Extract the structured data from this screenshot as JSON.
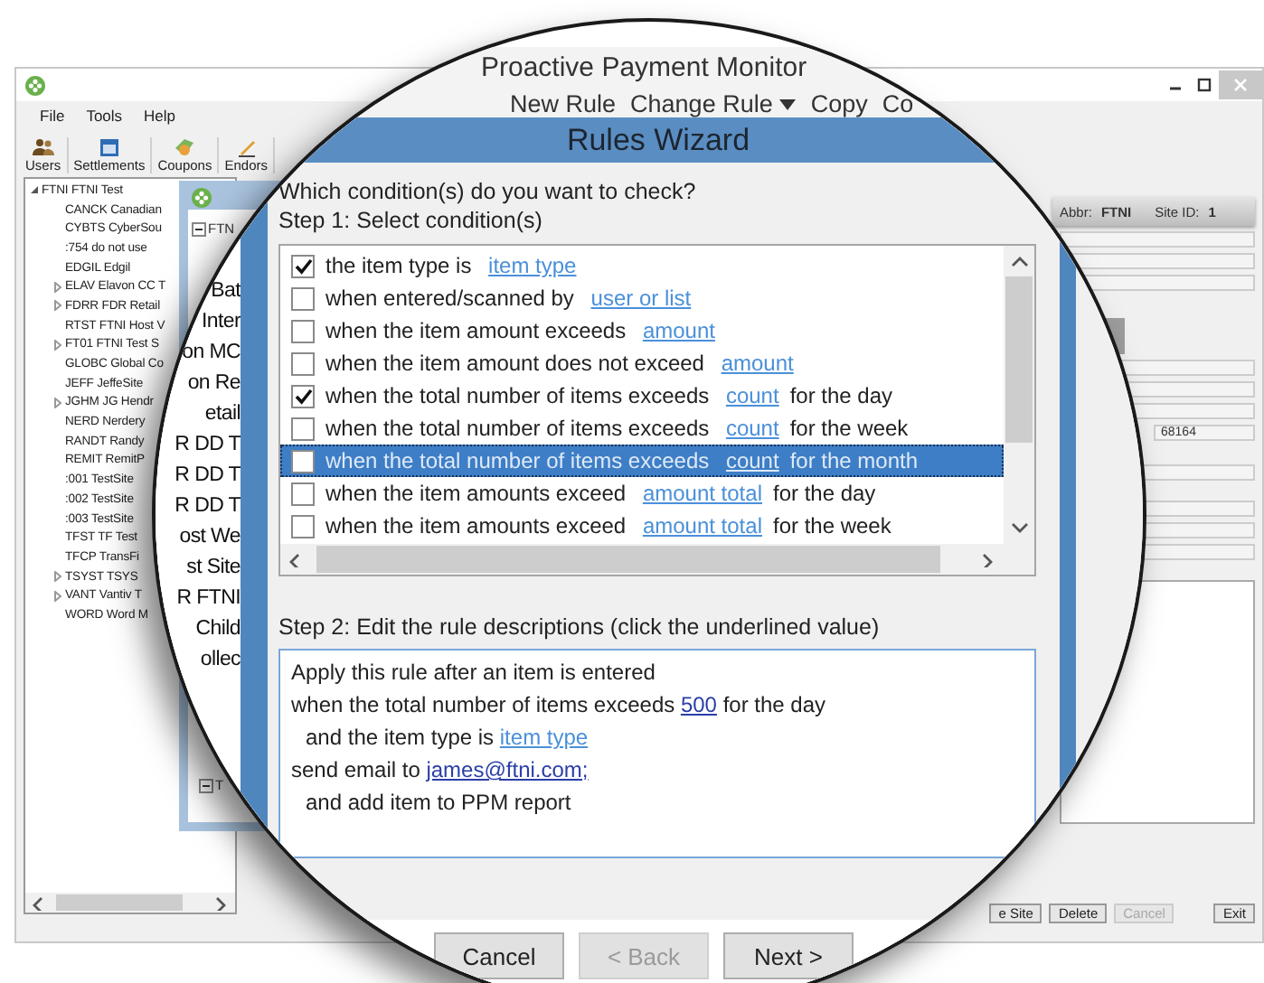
{
  "app": {
    "menu": [
      "File",
      "Tools",
      "Help"
    ],
    "toolbar": [
      "Users",
      "Settlements",
      "Coupons",
      "Endors"
    ],
    "tree": {
      "label": "FTNI FTNI Test",
      "expanded": true,
      "children": [
        {
          "label": "CANCK Canadian",
          "expandable": false
        },
        {
          "label": "CYBTS CyberSou",
          "expandable": false
        },
        {
          "label": ":754 do not use",
          "expandable": false
        },
        {
          "label": "EDGIL Edgil",
          "expandable": false
        },
        {
          "label": "ELAV Elavon CC T",
          "expandable": true
        },
        {
          "label": "FDRR FDR Retail",
          "expandable": true
        },
        {
          "label": "RTST FTNI Host V",
          "expandable": false
        },
        {
          "label": "FT01 FTNI Test S",
          "expandable": true
        },
        {
          "label": "GLOBC Global Co",
          "expandable": false
        },
        {
          "label": "JEFF JeffeSite",
          "expandable": false
        },
        {
          "label": "JGHM JG Hendr",
          "expandable": true
        },
        {
          "label": "NERD Nerdery",
          "expandable": false
        },
        {
          "label": "RANDT Randy",
          "expandable": false
        },
        {
          "label": "REMIT RemitP",
          "expandable": false
        },
        {
          "label": ":001 TestSite",
          "expandable": false
        },
        {
          "label": ":002 TestSite",
          "expandable": false
        },
        {
          "label": ":003 TestSite",
          "expandable": false
        },
        {
          "label": "TFST TF Test",
          "expandable": false
        },
        {
          "label": "TFCP TransFi",
          "expandable": false
        },
        {
          "label": "TSYST TSYS",
          "expandable": true
        },
        {
          "label": "VANT Vantiv T",
          "expandable": true
        },
        {
          "label": "WORD Word M",
          "expandable": false
        }
      ]
    },
    "site_header": {
      "abbr_label": "Abbr:",
      "abbr": "FTNI",
      "site_id_label": "Site ID:",
      "site_id": "1"
    },
    "field_value": "68164",
    "buttons": [
      {
        "label": "e Site",
        "disabled": false
      },
      {
        "label": "Delete",
        "disabled": false
      },
      {
        "label": "Cancel",
        "disabled": true
      },
      {
        "label": "Exit",
        "disabled": false
      }
    ]
  },
  "back_dialog": {
    "tree_top": "FTN",
    "tree_bottom": "T"
  },
  "magnifier": {
    "title": "Proactive Payment Monitor",
    "menu": [
      {
        "label": "New Rule",
        "dropdown": false
      },
      {
        "label": "Change Rule",
        "dropdown": true
      },
      {
        "label": "Copy",
        "dropdown": false
      },
      {
        "label": "Co",
        "dropdown": false
      }
    ],
    "background_text": [
      "Bat",
      "Inter",
      "on MC",
      "on Re",
      "etail",
      "R DD T",
      "R DD T",
      "R DD T",
      "ost We",
      "st Site",
      "R FTNI",
      "Child",
      "ollec"
    ],
    "wizard": {
      "title": "Rules Wizard",
      "question": "Which condition(s) do you want to check?",
      "step1": "Step 1: Select condition(s)",
      "conditions": [
        {
          "text": "the item type is ",
          "link": "item type",
          "checked": true,
          "selected": false
        },
        {
          "text": "when entered/scanned by ",
          "link": "user or list",
          "checked": false,
          "selected": false
        },
        {
          "text": "when the item amount exceeds ",
          "link": "amount",
          "checked": false,
          "selected": false
        },
        {
          "text": "when the item amount does not exceed ",
          "link": "amount",
          "checked": false,
          "selected": false
        },
        {
          "text": "when the total number of items exceeds ",
          "link": "count",
          "after": "for the day",
          "checked": true,
          "selected": false
        },
        {
          "text": "when the total number of items exceeds ",
          "link": "count",
          "after": "for the week",
          "checked": false,
          "selected": false
        },
        {
          "text": "when the total number of items exceeds ",
          "link": "count",
          "after": "for the month",
          "checked": false,
          "selected": true
        },
        {
          "text": "when the item amounts exceed ",
          "link": "amount total",
          "after": "for the day",
          "checked": false,
          "selected": false
        },
        {
          "text": "when the item amounts exceed ",
          "link": "amount total",
          "after": "for the week",
          "checked": false,
          "selected": false
        }
      ],
      "step2": "Step 2: Edit the rule descriptions (click the underlined value)",
      "description": [
        {
          "kind": "line",
          "text": "Apply this rule after an item is entered"
        },
        {
          "kind": "line",
          "text": "when the total number of items exceeds ",
          "link": "500",
          "link_set": true,
          "after": " for the day"
        },
        {
          "kind": "indented",
          "text": "and the item type is ",
          "link": "item type",
          "link_set": false
        },
        {
          "kind": "line",
          "text": "send email to ",
          "link": "james@ftni.com;",
          "link_set": true
        },
        {
          "kind": "indented",
          "text": "and add item to PPM report"
        }
      ],
      "buttons": [
        {
          "label": "Cancel",
          "disabled": false
        },
        {
          "label": "< Back",
          "disabled": true
        },
        {
          "label": "Next >",
          "disabled": false
        }
      ]
    }
  }
}
